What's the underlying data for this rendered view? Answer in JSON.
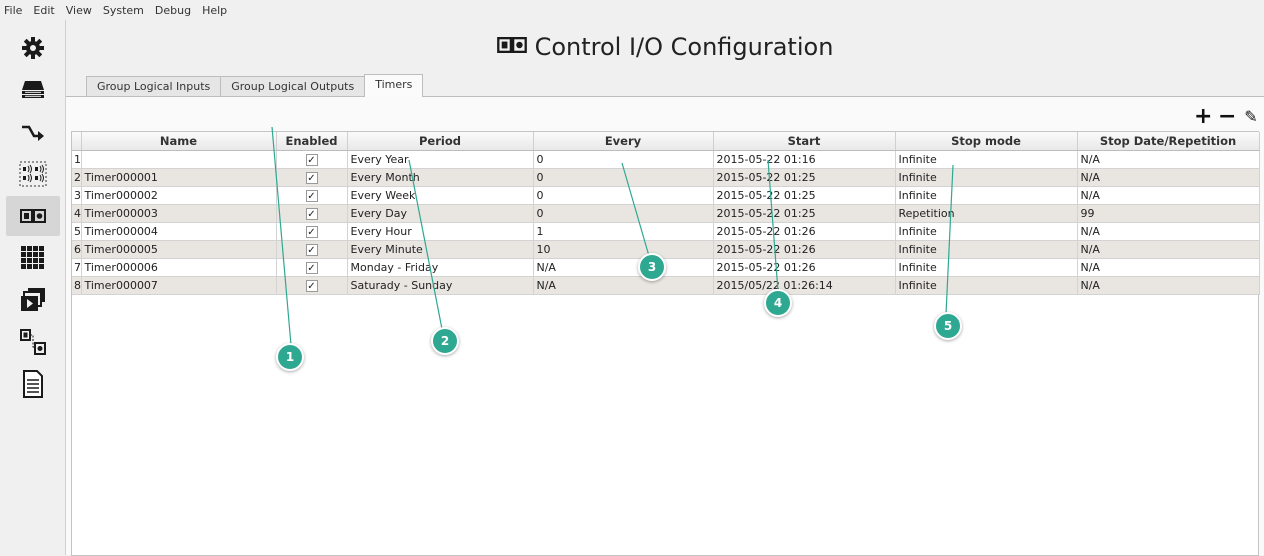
{
  "menu": [
    "File",
    "Edit",
    "View",
    "System",
    "Debug",
    "Help"
  ],
  "sidebar": {
    "items": [
      {
        "icon": "gear-icon"
      },
      {
        "icon": "network-device-icon"
      },
      {
        "icon": "route-arrow-icon"
      },
      {
        "icon": "audio-zones-icon",
        "glyph": "◂))◂))\n◂))◂))"
      },
      {
        "icon": "control-io-icon",
        "active": true
      },
      {
        "icon": "grid-icon"
      },
      {
        "icon": "video-stack-icon"
      },
      {
        "icon": "io-link-icon"
      },
      {
        "icon": "document-icon"
      }
    ]
  },
  "title": {
    "text": "Control I/O Configuration",
    "icon_glyph": "◫◙"
  },
  "tabs": [
    {
      "label": "Group Logical Inputs",
      "active": false
    },
    {
      "label": "Group Logical Outputs",
      "active": false
    },
    {
      "label": "Timers",
      "active": true
    }
  ],
  "toolbar": {
    "add": "+",
    "remove": "−",
    "clear_icon": "brush-icon",
    "clear": "✎"
  },
  "table": {
    "columns": [
      "",
      "Name",
      "Enabled",
      "Period",
      "Every",
      "Start",
      "Stop mode",
      "Stop Date/Repetition"
    ],
    "check_glyph": "✓",
    "rows": [
      {
        "num": "1",
        "name": "",
        "enabled": true,
        "period": "Every Year",
        "every": "0",
        "start": "2015-05-22 01:16",
        "stop_mode": "Infinite",
        "stop_value": "N/A"
      },
      {
        "num": "2",
        "name": "Timer000001",
        "enabled": true,
        "period": "Every Month",
        "every": "0",
        "start": "2015-05-22 01:25",
        "stop_mode": "Infinite",
        "stop_value": "N/A"
      },
      {
        "num": "3",
        "name": "Timer000002",
        "enabled": true,
        "period": "Every Week",
        "every": "0",
        "start": "2015-05-22 01:25",
        "stop_mode": "Infinite",
        "stop_value": "N/A"
      },
      {
        "num": "4",
        "name": "Timer000003",
        "enabled": true,
        "period": "Every Day",
        "every": "0",
        "start": "2015-05-22 01:25",
        "stop_mode": "Repetition",
        "stop_value": "99"
      },
      {
        "num": "5",
        "name": "Timer000004",
        "enabled": true,
        "period": "Every Hour",
        "every": "1",
        "start": "2015-05-22 01:26",
        "stop_mode": "Infinite",
        "stop_value": "N/A"
      },
      {
        "num": "6",
        "name": "Timer000005",
        "enabled": true,
        "period": "Every Minute",
        "every": "10",
        "start": "2015-05-22 01:26",
        "stop_mode": "Infinite",
        "stop_value": "N/A"
      },
      {
        "num": "7",
        "name": "Timer000006",
        "enabled": true,
        "period": "Monday - Friday",
        "every": "N/A",
        "start": "2015-05-22 01:26",
        "stop_mode": "Infinite",
        "stop_value": "N/A"
      },
      {
        "num": "8",
        "name": "Timer000007",
        "enabled": true,
        "period": "Saturady - Sunday",
        "every": "N/A",
        "start": "2015/05/22 01:26:14",
        "stop_mode": "Infinite",
        "stop_value": "N/A"
      }
    ]
  },
  "callouts": [
    "1",
    "2",
    "3",
    "4",
    "5"
  ],
  "colors": {
    "callout": "#2fa892",
    "row_alt": "#e9e6e1"
  }
}
